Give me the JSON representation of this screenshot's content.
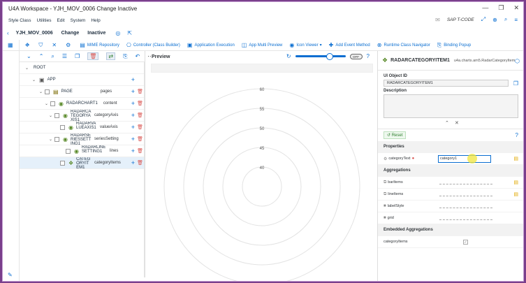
{
  "window": {
    "title": "U4A Workspace - YJH_MOV_0006 Change Inactive"
  },
  "menu": {
    "items": [
      "Style Class",
      "Utilities",
      "Edit",
      "System",
      "Help"
    ],
    "tcode": "SAP T-CODE"
  },
  "header": {
    "app": "YJH_MOV_0006",
    "mode": "Change",
    "status": "Inactive"
  },
  "toolbar": {
    "items": [
      "MIME Repository",
      "Controller (Class Builder)",
      "Application Execution",
      "App Multi Preview",
      "Icon Viewer",
      "Add Event Method",
      "Runtime Class Navigator",
      "Binding Popup"
    ]
  },
  "tree": {
    "rows": [
      {
        "label": "ROOT",
        "agg": ""
      },
      {
        "label": "APP",
        "agg": ""
      },
      {
        "label": "PAGE",
        "agg": "pages"
      },
      {
        "label": "RADARCHART1",
        "agg": "content"
      },
      {
        "label": "RADARCATEGORYAXIS1",
        "agg": "categoryAxis"
      },
      {
        "label": "RADARVALUEAXIS1",
        "agg": "valueAxis"
      },
      {
        "label": "RADARSERIESSETTING1",
        "agg": "seriesSetting"
      },
      {
        "label": "RADARLINESETTING1",
        "agg": "lines"
      },
      {
        "label": "CATEGORYITEM1",
        "agg": "categoryItems"
      }
    ]
  },
  "preview": {
    "title": "Preview",
    "toggle": "OFF"
  },
  "chart_data": {
    "type": "radar",
    "ticks": [
      40,
      45,
      50,
      55,
      60
    ]
  },
  "props": {
    "name": "RADARCATEGORYITEM1",
    "class": "u4a.charts.am5.RadarCategoryItem",
    "id_label": "UI Object ID",
    "id_value": "RADARCATEGORYITEM1",
    "desc_label": "Description",
    "reset": "Reset",
    "properties_label": "Properties",
    "category_text_label": "categoryText",
    "category_text_value": "category1",
    "aggregations_label": "Aggregations",
    "aggs": [
      "barItems",
      "lineItems",
      "labelStyle",
      "grid"
    ],
    "embedded_label": "Embedded Aggregations",
    "embedded": [
      "categoryItems"
    ]
  }
}
